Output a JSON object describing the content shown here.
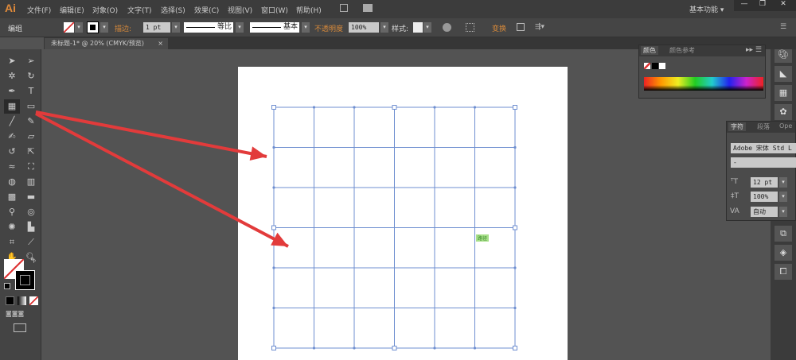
{
  "app": {
    "logo": "Ai",
    "workspace": "基本功能 ▾"
  },
  "menu": [
    "文件(F)",
    "编辑(E)",
    "对象(O)",
    "文字(T)",
    "选择(S)",
    "效果(C)",
    "视图(V)",
    "窗口(W)",
    "帮助(H)"
  ],
  "window_buttons": {
    "minimize": "—",
    "restore": "❐",
    "close": "✕"
  },
  "control": {
    "selection": "编组",
    "stroke_label": "描边:",
    "stroke_weight": "1 pt",
    "profile": "等比",
    "brush": "基本",
    "opacity_label": "不透明度",
    "opacity": "100%",
    "style_label": "样式:",
    "transform": "变换"
  },
  "document_tab": {
    "title": "未标题-1* @ 20% (CMYK/预览)",
    "close": "×"
  },
  "color_panel": {
    "tabs": [
      "颜色",
      "颜色参考"
    ]
  },
  "character_panel": {
    "tabs": [
      "字符",
      "段落",
      "Ope"
    ],
    "font": "Adobe 宋体 Std L",
    "style": "-",
    "size": "12 pt",
    "leading": "100%",
    "tracking": "自动"
  },
  "canvas": {
    "path_label": "路径",
    "grid_rows": 6,
    "grid_cols": 6,
    "grid_color": "#6f8fd0",
    "arrow_color": "#e23b3b"
  }
}
